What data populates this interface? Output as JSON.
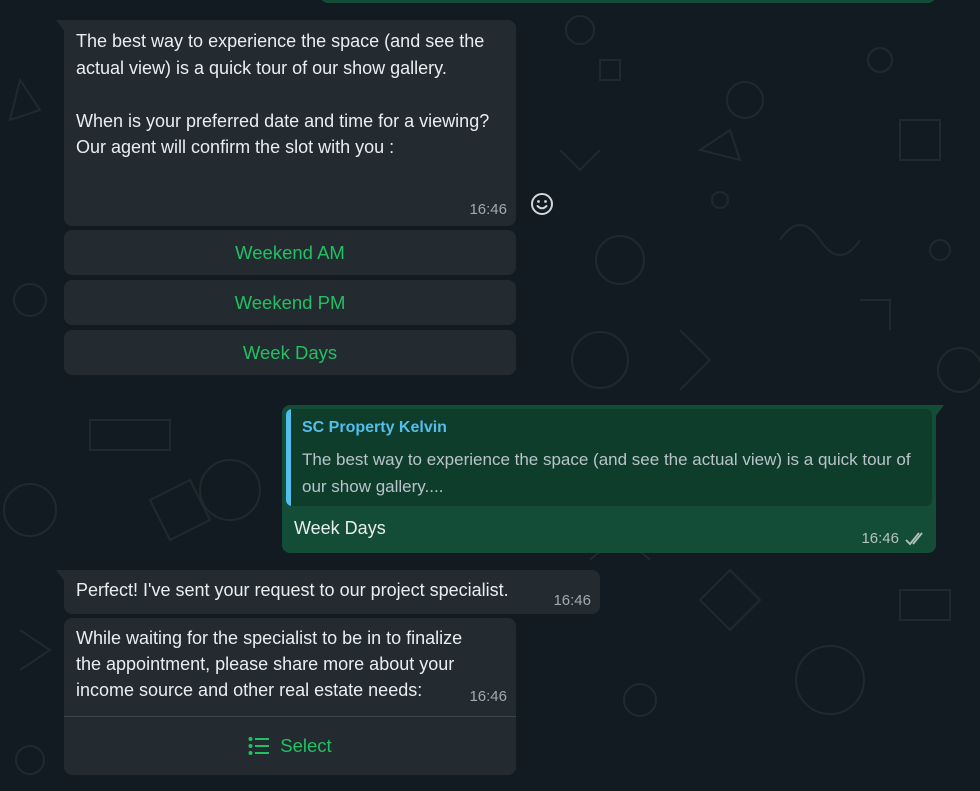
{
  "messages": {
    "m1": {
      "text": "The best way to experience the space (and see the actual view) is a quick tour of our show gallery.\n\nWhen is your preferred date and time for a viewing? Our agent will confirm the slot with you :",
      "time": "16:46",
      "buttons": [
        "Weekend AM",
        "Weekend PM",
        "Week Days"
      ]
    },
    "m2": {
      "quote_author": "SC Property Kelvin",
      "quote_text": "The best way to experience the space (and see the actual view) is a quick tour of our show gallery....",
      "text": "Week Days",
      "time": "16:46",
      "status_icon": "double-check-icon"
    },
    "m3": {
      "text": "Perfect! I've sent your request to our project specialist.",
      "time": "16:46"
    },
    "m4": {
      "text": "While waiting for the specialist to be in to finalize the appointment, please share more about your income source and other real estate needs:",
      "time": "16:46",
      "action_label": "Select",
      "action_icon": "list-icon"
    }
  },
  "colors": {
    "background": "#111b21",
    "incoming_bubble": "#232b30",
    "outgoing_bubble": "#144d37",
    "button_text": "#21c063",
    "quote_author": "#53bdeb"
  }
}
